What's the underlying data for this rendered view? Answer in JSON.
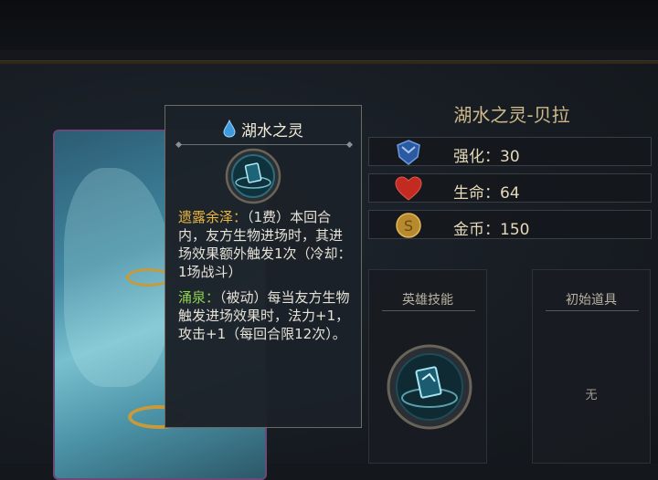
{
  "tooltip": {
    "title": "湖水之灵",
    "ability1_name": "遗露余泽：",
    "ability1_cost": "（1费）",
    "ability1_desc": "本回合内，友方生物进场时，其进场效果额外触发1次（冷却：1场战斗）",
    "ability2_name": "涌泉：",
    "ability2_desc": "（被动）每当友方生物触发进场效果时，法力+1，攻击+1（每回合限12次）。"
  },
  "hero": {
    "name": "湖水之灵-贝拉",
    "stats": [
      {
        "label": "强化：",
        "value": "30",
        "icon": "shield-icon"
      },
      {
        "label": "生命：",
        "value": "64",
        "icon": "heart-icon"
      },
      {
        "label": "金币：",
        "value": "150",
        "icon": "gold-coin-icon"
      }
    ]
  },
  "panels": {
    "skill_title": "英雄技能",
    "item_title": "初始道具",
    "item_value": "无"
  },
  "colors": {
    "gold_keyword": "#e9b63e",
    "green_keyword": "#8fd14f",
    "name_color": "#cdb98a"
  }
}
